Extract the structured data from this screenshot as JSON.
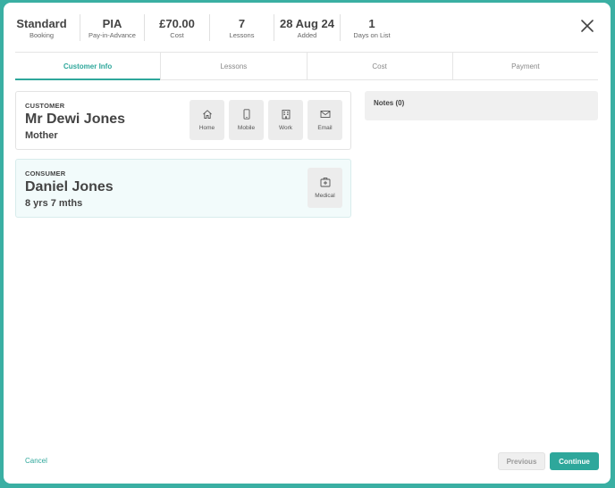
{
  "summary": [
    {
      "value": "Standard",
      "label": "Booking"
    },
    {
      "value": "PIA",
      "label": "Pay-in-Advance"
    },
    {
      "value": "£70.00",
      "label": "Cost"
    },
    {
      "value": "7",
      "label": "Lessons"
    },
    {
      "value": "28 Aug 24",
      "label": "Added"
    },
    {
      "value": "1",
      "label": "Days on List"
    }
  ],
  "tabs": [
    {
      "label": "Customer Info",
      "active": true
    },
    {
      "label": "Lessons",
      "active": false
    },
    {
      "label": "Cost",
      "active": false
    },
    {
      "label": "Payment",
      "active": false
    }
  ],
  "customer": {
    "caption": "CUSTOMER",
    "name": "Mr Dewi Jones",
    "relation": "Mother",
    "actions": [
      {
        "label": "Home",
        "icon": "home-icon"
      },
      {
        "label": "Mobile",
        "icon": "mobile-icon"
      },
      {
        "label": "Work",
        "icon": "building-icon"
      },
      {
        "label": "Email",
        "icon": "envelope-icon"
      }
    ]
  },
  "consumer": {
    "caption": "CONSUMER",
    "name": "Daniel Jones",
    "age": "8 yrs 7 mths",
    "actions": [
      {
        "label": "Medical",
        "icon": "medical-kit-icon"
      }
    ]
  },
  "notes": {
    "label": "Notes (0)"
  },
  "footer": {
    "cancel": "Cancel",
    "previous": "Previous",
    "continue": "Continue"
  },
  "colors": {
    "accent": "#2ea79b",
    "background": "#3aafa3"
  }
}
